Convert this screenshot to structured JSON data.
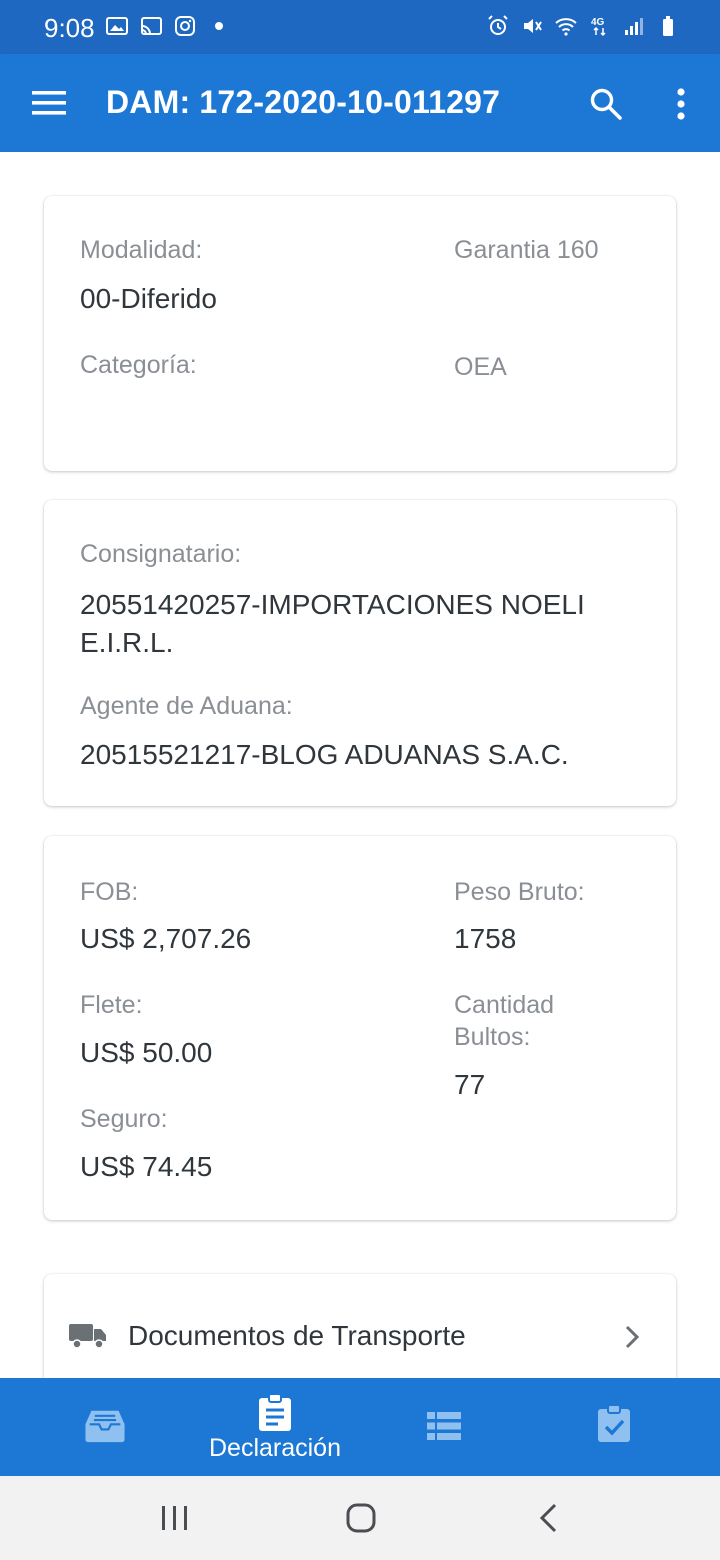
{
  "status_bar": {
    "time": "9:08",
    "left_icons": [
      "gallery-icon",
      "cast-icon",
      "instagram-icon",
      "dot-icon"
    ],
    "right_icons": [
      "alarm-icon",
      "mute-icon",
      "wifi-icon",
      "4g-icon",
      "signal-icon",
      "battery-icon"
    ],
    "network_label": "4G"
  },
  "app_bar": {
    "title": "DAM: 172-2020-10-011297",
    "menu_icon": "hamburger-menu-icon",
    "search_icon": "search-icon",
    "more_icon": "more-vert-icon"
  },
  "card_general": {
    "modalidad_label": "Modalidad:",
    "modalidad_value": "00-Diferido",
    "garantia_label": "Garantia 160",
    "categoria_label": "Categoría:",
    "oea_label": "OEA"
  },
  "card_parties": {
    "consignatario_label": "Consignatario:",
    "consignatario_value_line1": "20551420257-IMPORTACIONES NOELI",
    "consignatario_value_line2": "E.I.R.L.",
    "agente_label": "Agente de Aduana:",
    "agente_value": "20515521217-BLOG ADUANAS S.A.C."
  },
  "card_values": {
    "fob_label": "FOB:",
    "fob_value": "US$ 2,707.26",
    "flete_label": "Flete:",
    "flete_value": "US$ 50.00",
    "seguro_label": "Seguro:",
    "seguro_value": "US$ 74.45",
    "peso_label": "Peso Bruto:",
    "peso_value": "1758",
    "cantidad_label_line1": "Cantidad",
    "cantidad_label_line2": "Bultos:",
    "cantidad_value": "77"
  },
  "card_documents": {
    "label": "Documentos de Transporte",
    "icon": "truck-icon"
  },
  "bottom_nav": {
    "items": [
      {
        "icon": "inbox-icon",
        "label": ""
      },
      {
        "icon": "clipboard-icon",
        "label": "Declaración"
      },
      {
        "icon": "list-icon",
        "label": ""
      },
      {
        "icon": "clipboard-check-icon",
        "label": ""
      }
    ],
    "active_index": 1
  },
  "colors": {
    "status_bar": "#1f68c1",
    "app_bar": "#1c78d4",
    "label_gray": "#8a8f95",
    "value_dark": "#2f363c",
    "nav_icon_inactive": "#8fc0f0"
  }
}
